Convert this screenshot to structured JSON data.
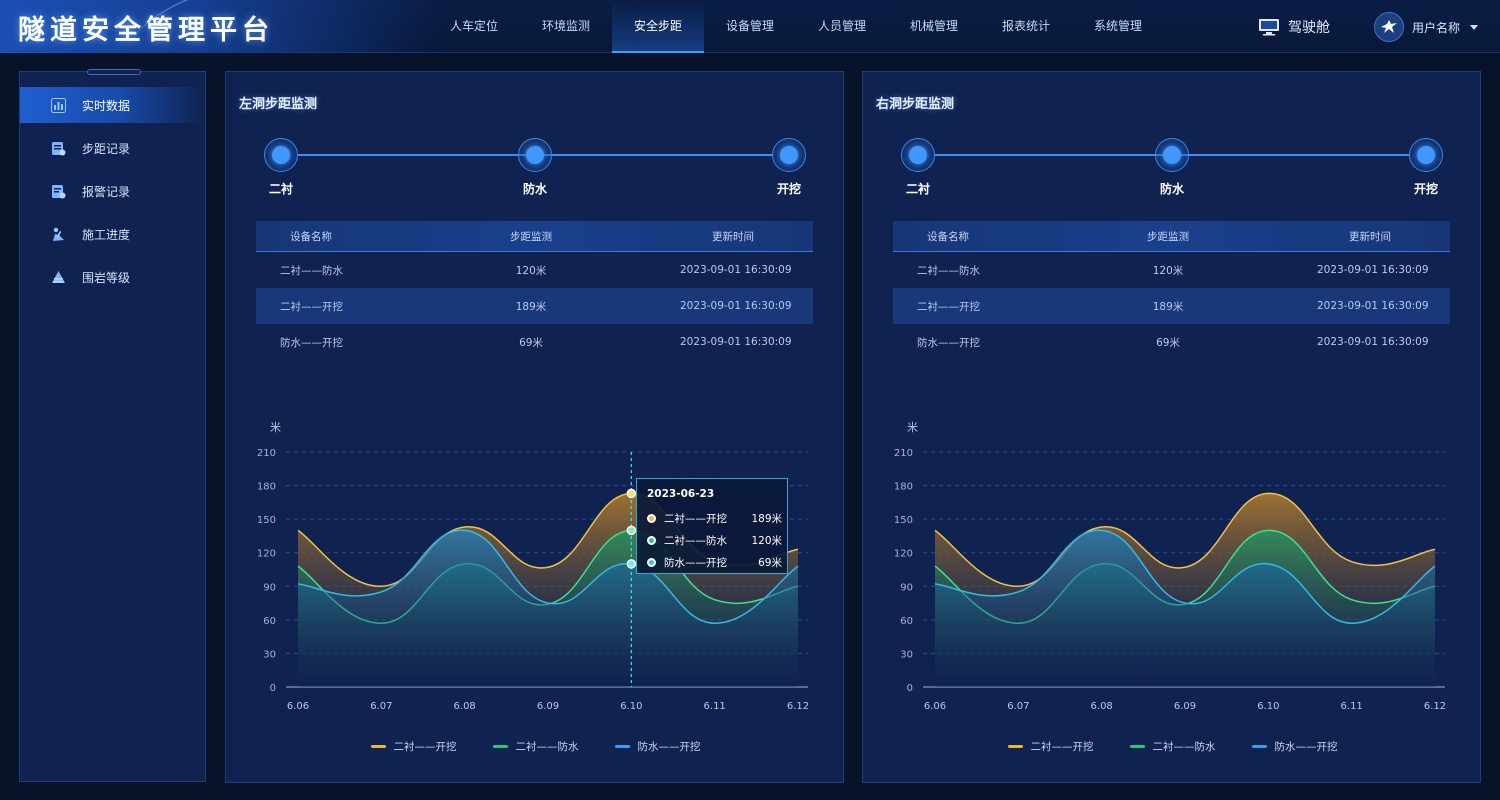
{
  "app": {
    "title": "隧道安全管理平台"
  },
  "nav": {
    "items": [
      {
        "label": "人车定位"
      },
      {
        "label": "环境监测"
      },
      {
        "label": "安全步距",
        "active": true
      },
      {
        "label": "设备管理"
      },
      {
        "label": "人员管理"
      },
      {
        "label": "机械管理"
      },
      {
        "label": "报表统计"
      },
      {
        "label": "系统管理"
      }
    ],
    "cockpit_label": "驾驶舱",
    "user_name": "用户名称"
  },
  "sidebar": {
    "items": [
      {
        "label": "实时数据",
        "icon": "bar-chart-icon",
        "active": true
      },
      {
        "label": "步距记录",
        "icon": "record-icon"
      },
      {
        "label": "报警记录",
        "icon": "alarm-record-icon"
      },
      {
        "label": "施工进度",
        "icon": "construction-icon"
      },
      {
        "label": "围岩等级",
        "icon": "rock-level-icon"
      }
    ]
  },
  "colors": {
    "accent": "#3aa0ff",
    "series1": "#f0b53a",
    "series2": "#27c87a",
    "series3": "#3e9cf0"
  },
  "left": {
    "title": "左洞步距监测",
    "steps": [
      "二衬",
      "防水",
      "开挖"
    ],
    "table": {
      "headers": [
        "设备名称",
        "步距监测",
        "更新时间"
      ],
      "rows": [
        [
          "二衬——防水",
          "120米",
          "2023-09-01 16:30:09"
        ],
        [
          "二衬——开挖",
          "189米",
          "2023-09-01 16:30:09"
        ],
        [
          "防水——开挖",
          "69米",
          "2023-09-01 16:30:09"
        ]
      ]
    },
    "tooltip": {
      "date": "2023-06-23",
      "rows": [
        {
          "name": "二衬——开挖",
          "value": "189米"
        },
        {
          "name": "二衬——防水",
          "value": "120米"
        },
        {
          "name": "防水——开挖",
          "value": "69米"
        }
      ]
    }
  },
  "right": {
    "title": "右洞步距监测",
    "steps": [
      "二衬",
      "防水",
      "开挖"
    ],
    "table": {
      "headers": [
        "设备名称",
        "步距监测",
        "更新时间"
      ],
      "rows": [
        [
          "二衬——防水",
          "120米",
          "2023-09-01 16:30:09"
        ],
        [
          "二衬——开挖",
          "189米",
          "2023-09-01 16:30:09"
        ],
        [
          "防水——开挖",
          "69米",
          "2023-09-01 16:30:09"
        ]
      ]
    }
  },
  "chart_data": [
    {
      "type": "area",
      "ylabel": "米",
      "ylim": [
        0,
        210
      ],
      "yticks": [
        0,
        30,
        60,
        90,
        120,
        150,
        180,
        210
      ],
      "categories": [
        "6.06",
        "6.07",
        "6.08",
        "6.09",
        "6.10",
        "6.11",
        "6.12"
      ],
      "grid": true,
      "legend": "bottom",
      "highlight_index": 4,
      "series": [
        {
          "name": "二衬——开挖",
          "values": [
            140,
            90,
            143,
            107,
            173,
            112,
            123
          ]
        },
        {
          "name": "二衬——防水",
          "values": [
            108,
            57,
            110,
            74,
            140,
            78,
            90
          ]
        },
        {
          "name": "防水——开挖",
          "values": [
            92,
            85,
            140,
            75,
            110,
            57,
            108
          ]
        }
      ]
    },
    {
      "type": "area",
      "ylabel": "米",
      "ylim": [
        0,
        210
      ],
      "yticks": [
        0,
        30,
        60,
        90,
        120,
        150,
        180,
        210
      ],
      "categories": [
        "6.06",
        "6.07",
        "6.08",
        "6.09",
        "6.10",
        "6.11",
        "6.12"
      ],
      "grid": true,
      "legend": "bottom",
      "series": [
        {
          "name": "二衬——开挖",
          "values": [
            140,
            90,
            143,
            107,
            173,
            112,
            123
          ]
        },
        {
          "name": "二衬——防水",
          "values": [
            108,
            57,
            110,
            74,
            140,
            78,
            90
          ]
        },
        {
          "name": "防水——开挖",
          "values": [
            92,
            85,
            140,
            75,
            110,
            57,
            108
          ]
        }
      ]
    }
  ]
}
